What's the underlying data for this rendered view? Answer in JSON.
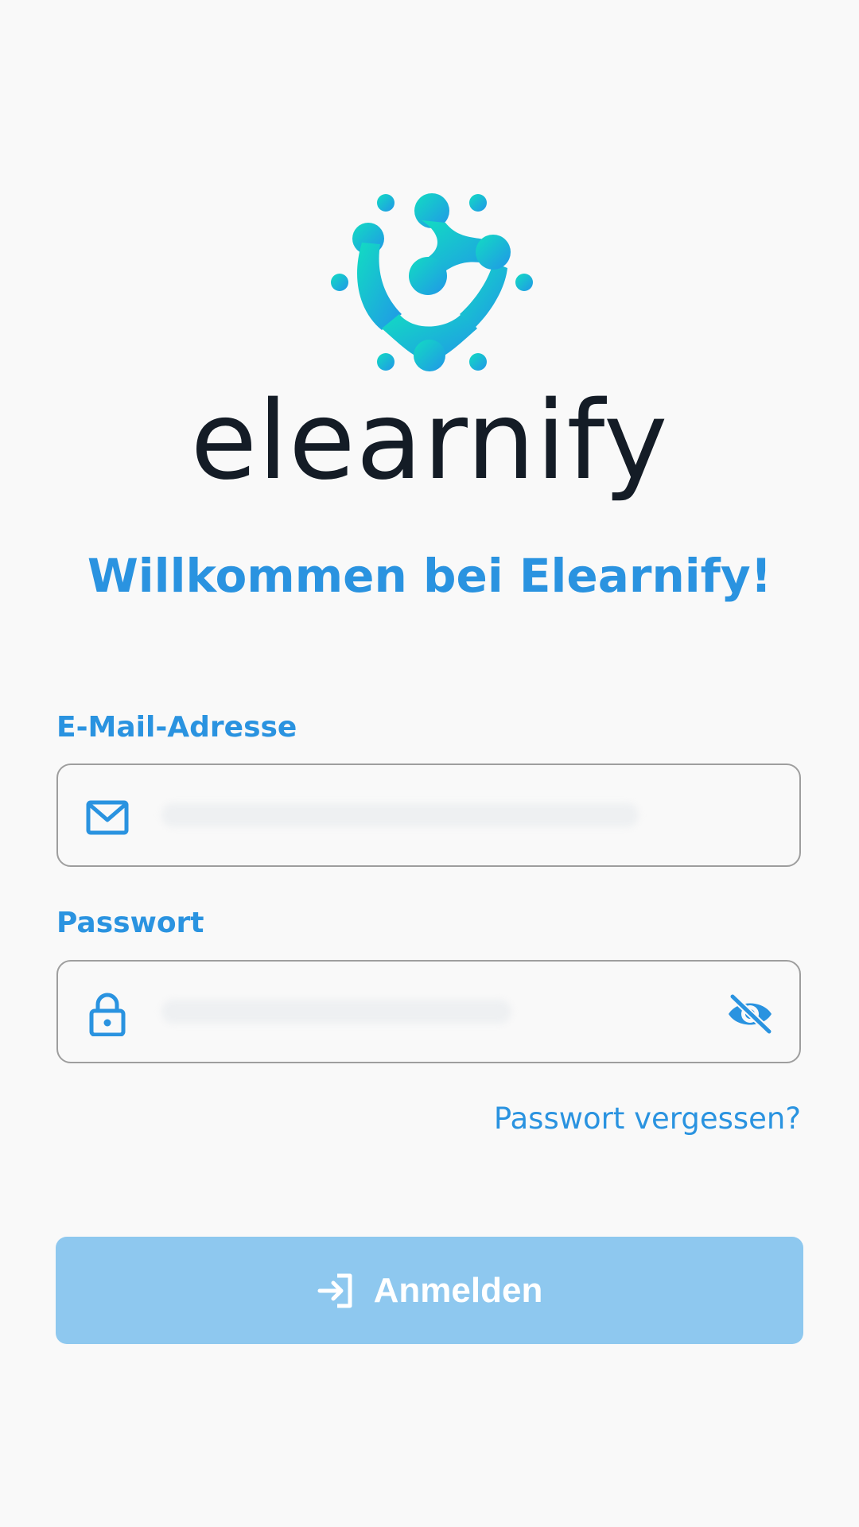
{
  "app": {
    "logo_icon": "network-dots-logo-icon",
    "wordmark": "elearnify",
    "welcome": "Willkommen bei Elearnify!"
  },
  "form": {
    "email": {
      "label": "E-Mail-Adresse",
      "icon": "mail-icon",
      "value": ""
    },
    "password": {
      "label": "Passwort",
      "icon": "lock-icon",
      "toggle_icon": "eye-off-icon",
      "value": ""
    },
    "forgot": "Passwort vergessen?",
    "submit": {
      "label": "Anmelden",
      "icon": "login-icon"
    }
  },
  "colors": {
    "accent": "#2a93e0",
    "button_disabled": "#8ec8ef",
    "background": "#f9f9f9",
    "wordmark": "#141c26",
    "logo_gradient_start": "#12d9c4",
    "logo_gradient_end": "#2196e8"
  }
}
